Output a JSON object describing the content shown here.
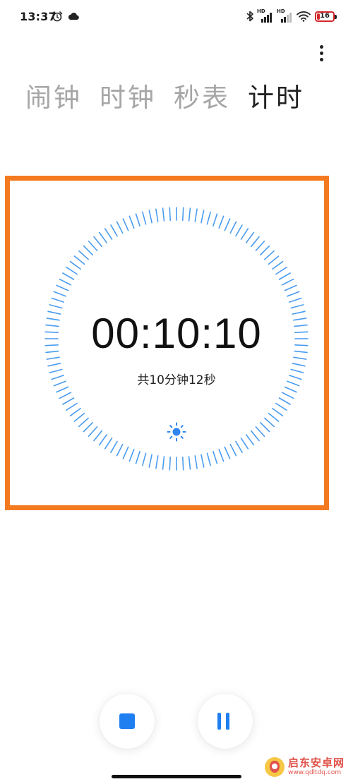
{
  "status_bar": {
    "time": "13:37",
    "icons_left": [
      "alarm-icon",
      "cloud-icon"
    ],
    "icons_right": [
      "bluetooth-icon",
      "hd-signal-icon",
      "hd-signal-icon",
      "wifi-icon",
      "battery-icon"
    ],
    "signal_label": "HD",
    "battery_level": "16",
    "battery_color": "#d4282b"
  },
  "tabs": [
    {
      "label": "闹钟",
      "active": false
    },
    {
      "label": "时钟",
      "active": false
    },
    {
      "label": "秒表",
      "active": false
    },
    {
      "label": "计时",
      "active": true
    }
  ],
  "timer": {
    "time": "00:10:10",
    "total": "共10分钟12秒",
    "tick_color": "#4a9cef"
  },
  "controls": {
    "stop_icon": "stop-icon",
    "pause_icon": "pause-icon",
    "accent": "#1f7ff0"
  },
  "highlight_color": "#f47a20",
  "watermark": {
    "name": "启东安卓网",
    "url": "www.qdltdq.com"
  }
}
